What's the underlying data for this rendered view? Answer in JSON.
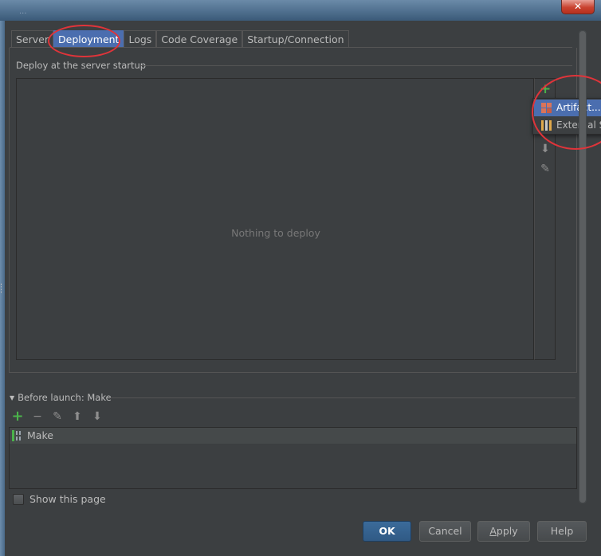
{
  "window": {
    "blurred_title": "...",
    "close_symbol": "✕"
  },
  "tabs": [
    {
      "label": "Server"
    },
    {
      "label": "Deployment",
      "active": true
    },
    {
      "label": "Logs"
    },
    {
      "label": "Code Coverage"
    },
    {
      "label": "Startup/Connection"
    }
  ],
  "deployment": {
    "section_title": "Deploy at the server startup",
    "empty_text": "Nothing to deploy",
    "toolbar_icons": [
      "add-icon",
      "arrow-down-icon",
      "pencil-icon"
    ],
    "add_symbol": "+",
    "down_symbol": "⬇",
    "edit_symbol": "✎"
  },
  "add_popup": {
    "items": [
      {
        "label": "Artifact...",
        "icon": "artifact-icon",
        "selected": true
      },
      {
        "label": "External Source...",
        "icon": "external-source-icon",
        "selected": false
      }
    ]
  },
  "before_launch": {
    "title": "Before launch: Make",
    "arrow": "▼",
    "toolbar": {
      "add": "+",
      "remove": "−",
      "edit": "✎",
      "up": "⬆",
      "down": "⬇"
    },
    "items": [
      {
        "label": "Make",
        "icon": "make-icon"
      }
    ]
  },
  "show_this_page": {
    "label": "Show this page",
    "checked": false
  },
  "buttons": {
    "ok": "OK",
    "cancel": "Cancel",
    "apply_underlined": "A",
    "apply_rest": "pply",
    "help": "Help"
  },
  "colors": {
    "background": "#3c3f41",
    "selection": "#4b6eaf",
    "text": "#bbbbbb",
    "annotation": "#e0343a",
    "add_green": "#4bb34b"
  }
}
